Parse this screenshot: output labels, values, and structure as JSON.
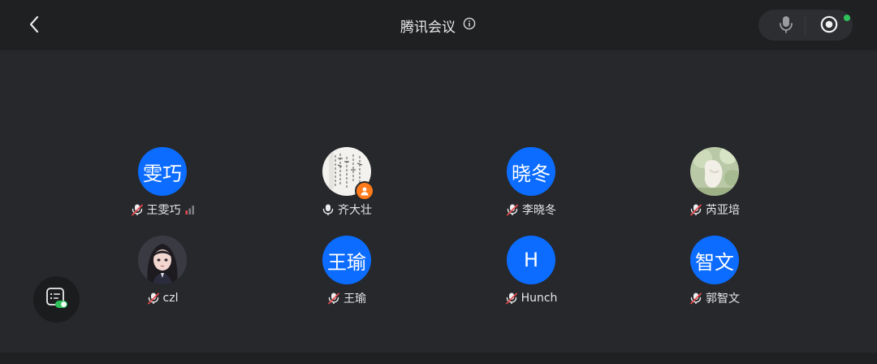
{
  "header": {
    "title": "腾讯会议"
  },
  "colors": {
    "background": "#26282b",
    "topbar": "#1e2022",
    "avatar_blue": "#0b6cff",
    "muted_red": "#e5484d",
    "live_green": "#2fc25b",
    "host_orange": "#ff7a1a"
  },
  "participants": [
    {
      "avatar_text": "雯巧",
      "name": "王雯巧",
      "mic": "muted",
      "signal": "weak-signal-icon"
    },
    {
      "avatar_text": "",
      "name": "齐大壮",
      "mic": "on",
      "host": true,
      "avatar_kind": "calligraphy-photo"
    },
    {
      "avatar_text": "晓冬",
      "name": "李晓冬",
      "mic": "muted"
    },
    {
      "avatar_text": "",
      "name": "芮亚培",
      "mic": "muted",
      "avatar_kind": "nature-photo"
    },
    {
      "avatar_text": "",
      "name": "czl",
      "mic": "muted",
      "avatar_kind": "illustrated-girl-photo"
    },
    {
      "avatar_text": "王瑜",
      "name": "王瑜",
      "mic": "muted"
    },
    {
      "avatar_text": "H",
      "name": "Hunch",
      "mic": "muted"
    },
    {
      "avatar_text": "智文",
      "name": "郭智文",
      "mic": "muted"
    }
  ],
  "icons": {
    "back": "chevron-left-icon",
    "info": "info-icon",
    "mic": "microphone-icon",
    "record": "record-icon",
    "chat": "chat-toggle-icon"
  }
}
